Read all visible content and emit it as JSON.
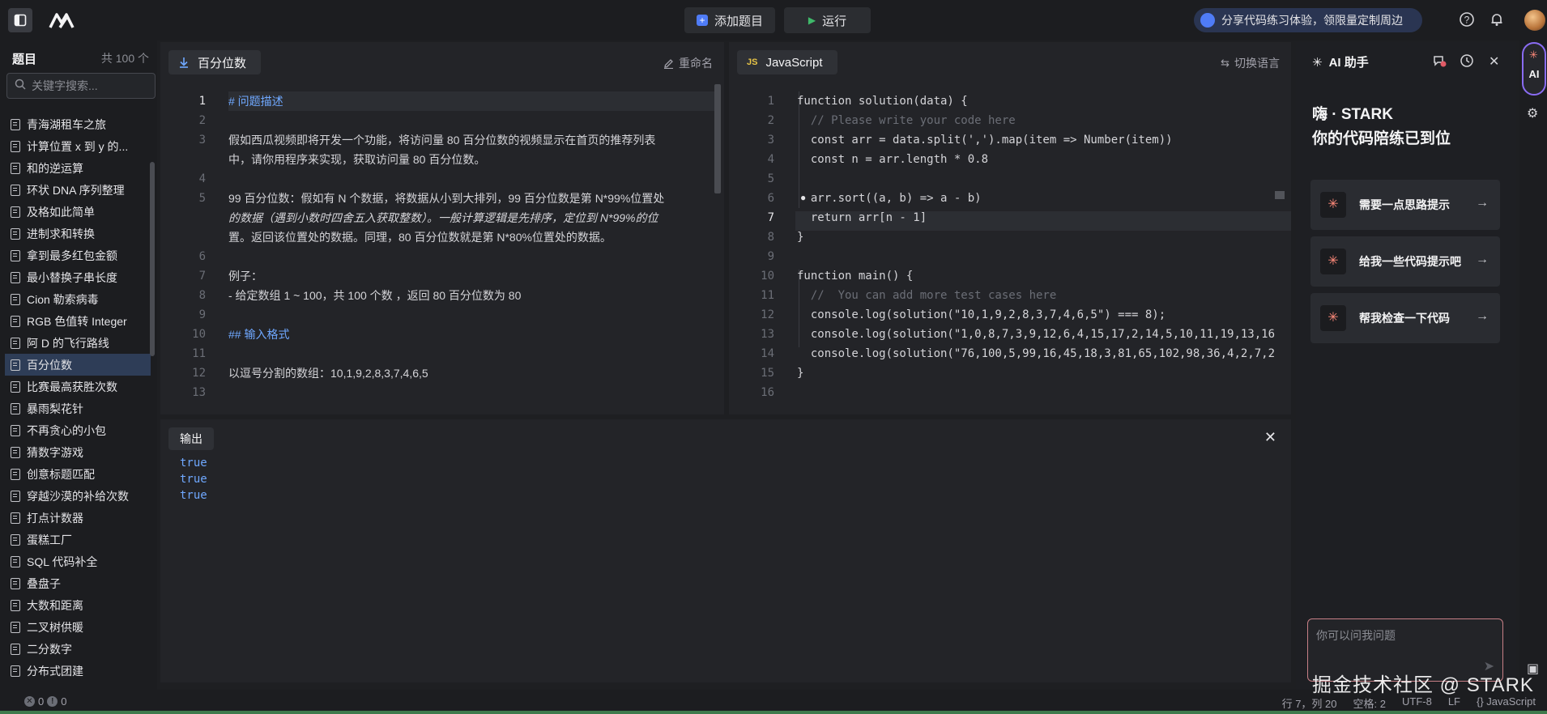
{
  "topbar": {
    "add_problem_label": "添加题目",
    "run_label": "运行",
    "share_text": "分享代码练习体验，领限量定制周边"
  },
  "sidebar": {
    "title": "题目",
    "count": "共 100 个",
    "search_placeholder": "关键字搜索...",
    "items": [
      "青海湖租车之旅",
      "计算位置 x 到 y 的...",
      "和的逆运算",
      "环状 DNA 序列整理",
      "及格如此简单",
      "进制求和转换",
      "拿到最多红包金额",
      "最小替换子串长度",
      "Cion 勒索病毒",
      "RGB 色值转 Integer",
      "阿 D 的飞行路线",
      "百分位数",
      "比赛最高获胜次数",
      "暴雨梨花针",
      "不再贪心的小包",
      "猜数字游戏",
      "创意标题匹配",
      "穿越沙漠的补给次数",
      "打点计数器",
      "蛋糕工厂",
      "SQL 代码补全",
      "叠盘子",
      "大数和距离",
      "二叉树供暖",
      "二分数字",
      "分布式团建"
    ],
    "active_index": 11
  },
  "description": {
    "tab_label": "百分位数",
    "rename_label": "重命名",
    "lines": [
      {
        "n": "1",
        "text": "# 问题描述",
        "style": "head"
      },
      {
        "n": "2",
        "text": "",
        "style": ""
      },
      {
        "n": "3",
        "text": "假如西瓜视频即将开发一个功能，将访问量 80 百分位数的视频显示在首页的推荐列表",
        "style": ""
      },
      {
        "n": "",
        "text": "中，请你用程序来实现，获取访问量 80 百分位数。",
        "style": ""
      },
      {
        "n": "4",
        "text": "",
        "style": ""
      },
      {
        "n": "5",
        "text": "99 百分位数：假如有 N 个数据，将数据从小到大排列，99 百分位数是第 N*99%位置处",
        "style": ""
      },
      {
        "n": "",
        "text": "的数据（遇到小数时四舍五入获取整数）。一般计算逻辑是先排序，定位到 N*99%的位",
        "style": "italic"
      },
      {
        "n": "",
        "text": "置。返回该位置处的数据。同理，80 百分位数就是第 N*80%位置处的数据。",
        "style": ""
      },
      {
        "n": "6",
        "text": "",
        "style": ""
      },
      {
        "n": "7",
        "text": "例子：",
        "style": ""
      },
      {
        "n": "8",
        "text": "- 给定数组 1 ~ 100，共 100 个数 ，返回 80 百分位数为 80",
        "style": ""
      },
      {
        "n": "9",
        "text": "",
        "style": ""
      },
      {
        "n": "10",
        "text": "## 输入格式",
        "style": "head"
      },
      {
        "n": "11",
        "text": "",
        "style": ""
      },
      {
        "n": "12",
        "text": "以逗号分割的数组：10,1,9,2,8,3,7,4,6,5",
        "style": ""
      },
      {
        "n": "13",
        "text": "",
        "style": ""
      }
    ]
  },
  "editor": {
    "tab_badge": "JS",
    "tab_label": "JavaScript",
    "switch_lang_label": "切换语言",
    "line_numbers": [
      "1",
      "2",
      "3",
      "4",
      "5",
      "6",
      "7",
      "8",
      "9",
      "10",
      "11",
      "12",
      "13",
      "14",
      "15",
      "16"
    ],
    "current_line": "7",
    "code": [
      "function solution(data) {",
      "  // Please write your code here",
      "  const arr = data.split(',').map(item => Number(item))",
      "  const n = arr.length * 0.8",
      "",
      "  arr.sort((a, b) => a - b)",
      "  return arr[n - 1]",
      "}",
      "",
      "function main() {",
      "  //  You can add more test cases here",
      "  console.log(solution(\"10,1,9,2,8,3,7,4,6,5\") === 8);",
      "  console.log(solution(\"1,0,8,7,3,9,12,6,4,15,17,2,14,5,10,11,19,13,16",
      "  console.log(solution(\"76,100,5,99,16,45,18,3,81,65,102,98,36,4,2,7,2",
      "}",
      ""
    ]
  },
  "output": {
    "tab_label": "输出",
    "lines": [
      "true",
      "true",
      "true"
    ]
  },
  "ai": {
    "title": "AI 助手",
    "greeting_line1": "嗨 · STARK",
    "greeting_line2": "你的代码陪练已到位",
    "cards": [
      "需要一点思路提示",
      "给我一些代码提示吧",
      "帮我检查一下代码"
    ],
    "input_placeholder": "你可以问我问题",
    "rail_label": "AI"
  },
  "status": {
    "errors": "0",
    "warnings": "0",
    "position": "行 7，列 20",
    "spaces": "空格: 2",
    "encoding": "UTF-8",
    "eol": "LF",
    "language": "{} JavaScript"
  },
  "watermark": "掘金技术社区 @ STARK"
}
